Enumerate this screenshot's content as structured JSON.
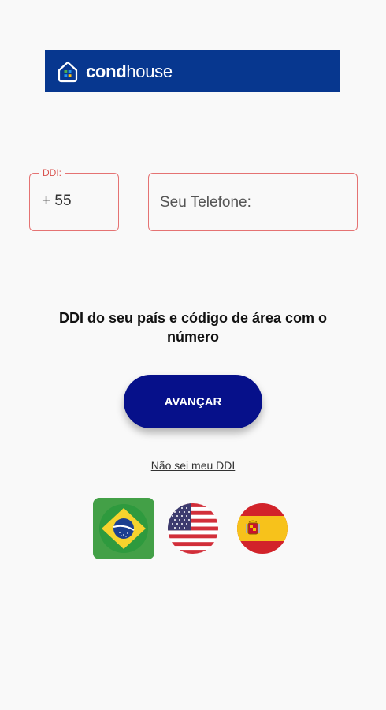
{
  "brand": {
    "name_bold": "cond",
    "name_light": "house",
    "banner_color": "#07378f"
  },
  "ddi": {
    "label": "DDI:",
    "value": "+ 55"
  },
  "phone": {
    "placeholder": "Seu Telefone:"
  },
  "instruction": "DDI do seu país e código de área com o número",
  "button": {
    "label": "AVANÇAR",
    "color": "#06108a"
  },
  "help_link": "Não sei meu DDI",
  "flags": [
    {
      "country": "Brasil",
      "icon": "brazil-flag-icon"
    },
    {
      "country": "Estados Unidos",
      "icon": "usa-flag-icon"
    },
    {
      "country": "Espanha",
      "icon": "spain-flag-icon"
    }
  ],
  "colors": {
    "error_border": "#e57373",
    "error_label": "#d9534f"
  }
}
